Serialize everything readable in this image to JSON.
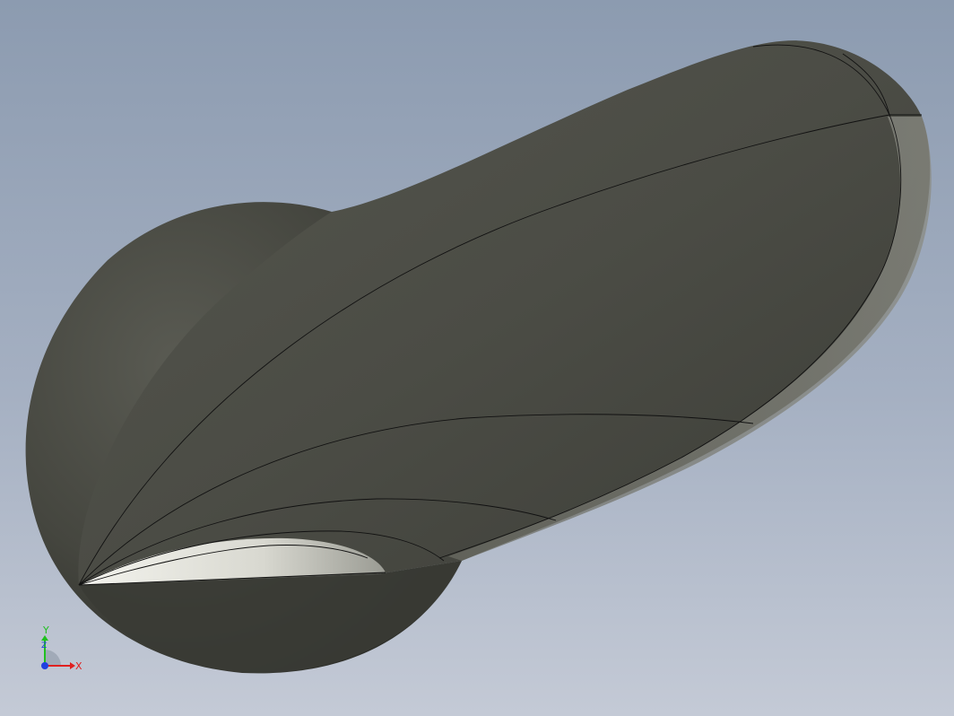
{
  "viewport": {
    "background_top": "#8c9bb0",
    "background_bottom": "#c4cad6"
  },
  "model": {
    "body_color": "#4a4b44",
    "highlight_color": "#e8e8e2",
    "edge_color": "#111111"
  },
  "triad": {
    "x_label": "X",
    "y_label": "Y",
    "z_label": "Z",
    "x_color": "#e02020",
    "y_color": "#20c020",
    "z_color": "#2040e0"
  }
}
